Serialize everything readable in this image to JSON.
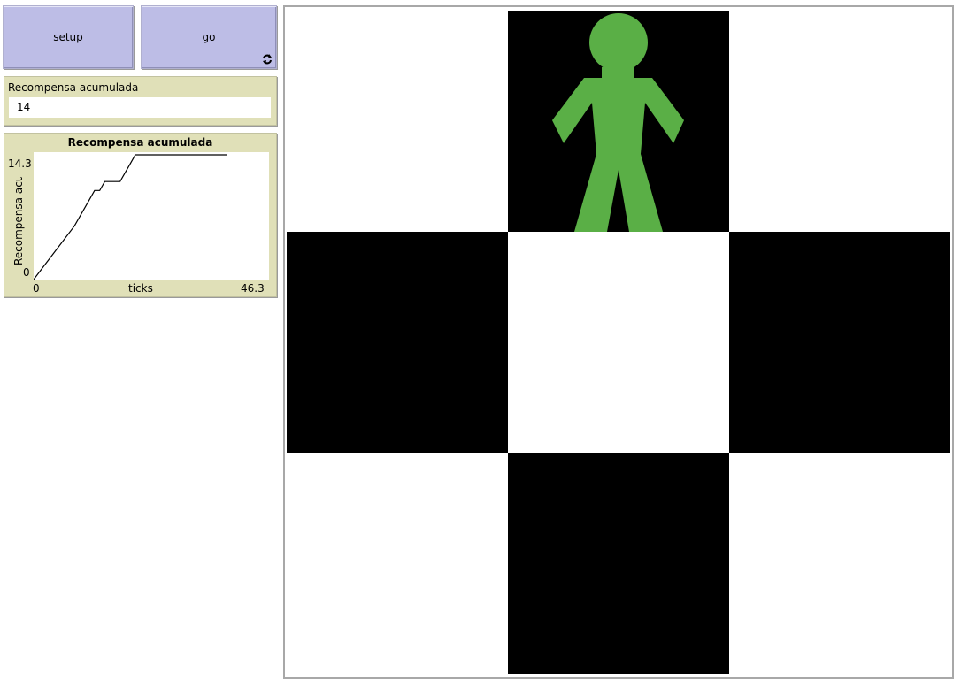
{
  "buttons": {
    "setup": "setup",
    "go": "go"
  },
  "monitor": {
    "label": "Recompensa acumulada",
    "value": "14"
  },
  "plot": {
    "title": "Recompensa acumulada",
    "xlabel": "ticks",
    "ylabel": "Recompensa acumulada",
    "xmin_label": "0",
    "xmax_label": "46.3",
    "ymin_label": "0",
    "ymax_label": "14.3"
  },
  "chart_data": {
    "type": "line",
    "title": "Recompensa acumulada",
    "xlabel": "ticks",
    "ylabel": "Recompensa acumulada",
    "xlim": [
      0,
      46.3
    ],
    "ylim": [
      0,
      14.3
    ],
    "series": [
      {
        "values": [
          [
            0,
            0
          ],
          [
            4,
            3
          ],
          [
            8,
            6
          ],
          [
            11,
            9
          ],
          [
            12,
            10
          ],
          [
            13,
            10
          ],
          [
            14,
            11
          ],
          [
            17,
            11
          ],
          [
            19,
            13
          ],
          [
            20,
            14
          ],
          [
            25,
            14
          ],
          [
            38,
            14
          ]
        ]
      }
    ]
  },
  "world": {
    "grid": [
      [
        "white",
        "black",
        "white"
      ],
      [
        "black",
        "white",
        "black"
      ],
      [
        "white",
        "black",
        "white"
      ]
    ],
    "agent": {
      "row": 0,
      "col": 1,
      "shape": "person-icon",
      "color": "#5aaf46"
    }
  },
  "colors": {
    "button": "#bdbde6",
    "monitor": "#e0e0b8",
    "agent": "#5aaf46"
  }
}
